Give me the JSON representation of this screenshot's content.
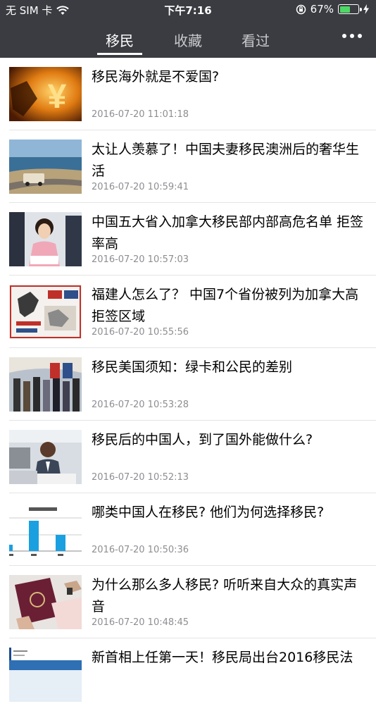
{
  "status_bar": {
    "carrier": "无 SIM 卡",
    "time": "下午7:16",
    "battery_percent": "67%",
    "battery_level": 0.67
  },
  "tabs": [
    {
      "label": "移民",
      "active": true
    },
    {
      "label": "收藏",
      "active": false
    },
    {
      "label": "看过",
      "active": false
    }
  ],
  "articles": [
    {
      "title": "移民海外就是不爱国?",
      "time": "2016-07-20 11:01:18"
    },
    {
      "title": "太让人羡慕了！中国夫妻移民澳洲后的奢华生活",
      "time": "2016-07-20 10:59:41"
    },
    {
      "title": "中国五大省入加拿大移民部内部高危名单 拒签率高",
      "time": "2016-07-20 10:57:03"
    },
    {
      "title": "福建人怎么了？ 中国7个省份被列为加拿大高拒签区域",
      "time": "2016-07-20 10:55:56"
    },
    {
      "title": "移民美国须知：绿卡和公民的差别",
      "time": "2016-07-20 10:53:28"
    },
    {
      "title": "移民后的中国人，到了国外能做什么?",
      "time": "2016-07-20 10:52:13"
    },
    {
      "title": "哪类中国人在移民? 他们为何选择移民?",
      "time": "2016-07-20 10:50:36"
    },
    {
      "title": "为什么那么多人移民? 听听来自大众的真实声音",
      "time": "2016-07-20 10:48:45"
    },
    {
      "title": "新首相上任第一天！移民局出台2016移民法",
      "time": ""
    }
  ]
}
